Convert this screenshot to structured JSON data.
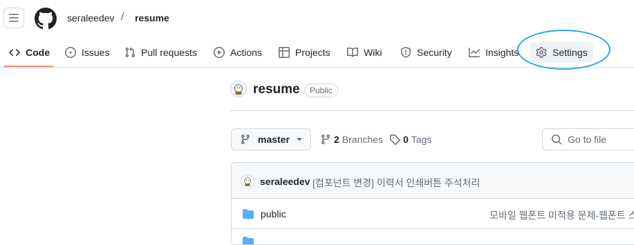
{
  "header": {
    "owner": "seraleedev",
    "separator": "/",
    "repo": "resume"
  },
  "tabs": [
    {
      "label": "Code",
      "icon": "code-icon",
      "selected": true
    },
    {
      "label": "Issues",
      "icon": "issue-opened-icon"
    },
    {
      "label": "Pull requests",
      "icon": "git-pull-request-icon"
    },
    {
      "label": "Actions",
      "icon": "play-icon"
    },
    {
      "label": "Projects",
      "icon": "table-icon"
    },
    {
      "label": "Wiki",
      "icon": "book-icon"
    },
    {
      "label": "Security",
      "icon": "shield-icon"
    },
    {
      "label": "Insights",
      "icon": "graph-icon"
    },
    {
      "label": "Settings",
      "icon": "gear-icon",
      "highlighted": true
    }
  ],
  "repo_header": {
    "title": "resume",
    "visibility": "Public"
  },
  "toolbar": {
    "branch": "master",
    "branches_count": "2",
    "branches_label": "Branches",
    "tags_count": "0",
    "tags_label": "Tags",
    "goto_placeholder": "Go to file"
  },
  "latest_commit": {
    "author": "seraleedev",
    "message": "[컴포넌트 변경] 이력서 인쇄버튼 주석처리"
  },
  "files": [
    {
      "name": "public",
      "type": "folder",
      "message": "모바일 웹폰트 미적용 문제-웹폰트 스"
    }
  ],
  "colors": {
    "accent_underline": "#fd8c73",
    "annotation_circle": "#2aa3dd",
    "folder": "#54aeff"
  }
}
